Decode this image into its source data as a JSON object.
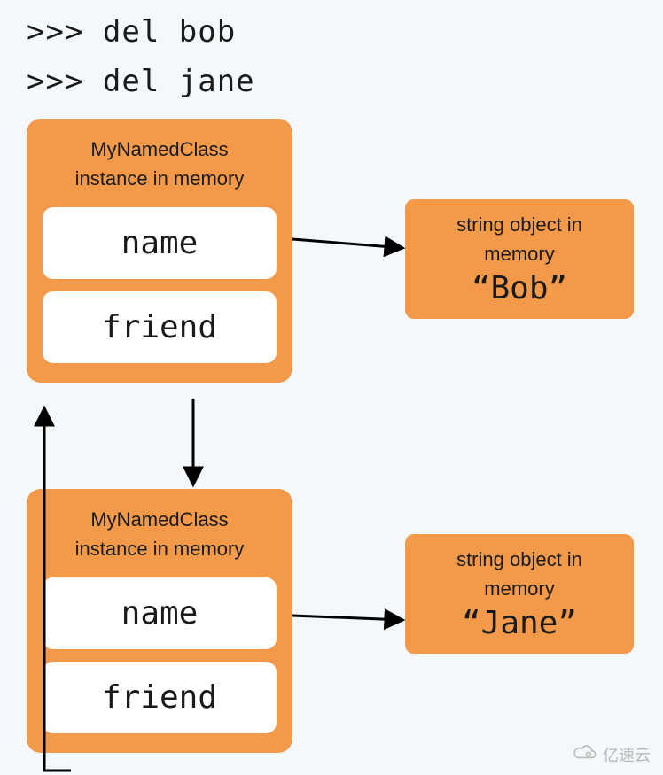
{
  "code": {
    "line1": ">>> del bob",
    "line2": ">>> del jane"
  },
  "instance1": {
    "title_l1": "MyNamedClass",
    "title_l2": "instance in memory",
    "attr1": "name",
    "attr2": "friend"
  },
  "instance2": {
    "title_l1": "MyNamedClass",
    "title_l2": "instance in memory",
    "attr1": "name",
    "attr2": "friend"
  },
  "string1": {
    "title_l1": "string object in",
    "title_l2": "memory",
    "value": "“Bob”"
  },
  "string2": {
    "title_l1": "string object in",
    "title_l2": "memory",
    "value": "“Jane”"
  },
  "watermark": "亿速云",
  "colors": {
    "accent": "#f2994a",
    "bg": "#f5f8fa"
  }
}
